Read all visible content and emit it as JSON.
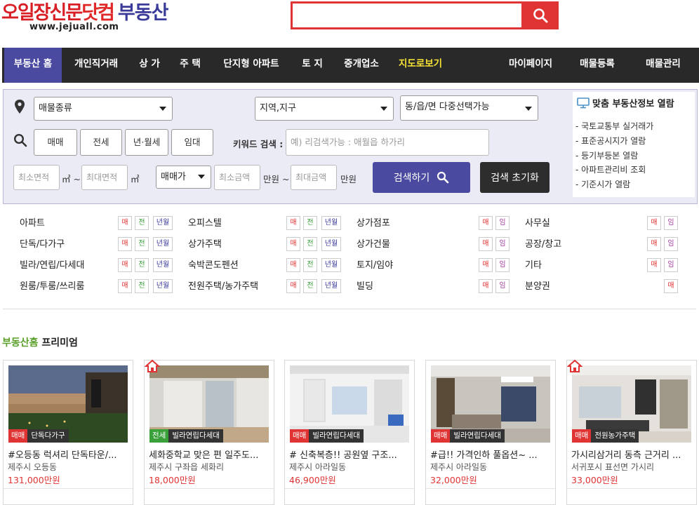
{
  "header": {
    "logo_part1": "오일장신문",
    "logo_part2": "닷컴",
    "logo_part3": "부동산",
    "logo_url": "www.jejuall.com",
    "search_placeholder": ""
  },
  "nav": {
    "items": [
      "부동산 홈",
      "개인직거래",
      "상 가",
      "주 택",
      "단지형 아파트",
      "토 지",
      "중개업소",
      "지도로보기"
    ],
    "right_items": [
      "마이페이지",
      "매물등록",
      "매물관리"
    ]
  },
  "filter": {
    "property_type": "매물종류",
    "region": "지역,지구",
    "dong": "동/읍/면 다중선택가능",
    "trade_buttons": [
      "매매",
      "전세",
      "년·월세",
      "임대"
    ],
    "keyword_label": "키워드 검색 :",
    "keyword_placeholder": "예) 리검색가능 : 애월읍 하가리",
    "min_area": "최소면적",
    "max_area": "최대면적",
    "area_unit": "㎡",
    "tilde": "~",
    "price_type": "매매가",
    "min_price": "최소금액",
    "max_price": "최대금액",
    "price_unit_tilde": "만원 ~",
    "price_unit": "만원",
    "search_button": "검색하기",
    "reset_button": "검색 초기화"
  },
  "side_panel": {
    "title": "맞춤 부동산정보 열람",
    "links": [
      "- 국토교통부 실거래가",
      "- 표준공시지가 열람",
      "- 등기부등본 열람",
      "- 아파트관리비 조회",
      "- 기준시가 열람"
    ]
  },
  "categories": {
    "col1": [
      "아파트",
      "단독/다가구",
      "빌라/연립/다세대",
      "원룸/투룸/쓰리룸"
    ],
    "col2": [
      "오피스텔",
      "상가주택",
      "숙박콘도펜션",
      "전원주택/농가주택"
    ],
    "col3": [
      "상가점포",
      "상가건물",
      "토지/임야",
      "빌딩"
    ],
    "col4": [
      "사무실",
      "공장/창고",
      "기타",
      "분양권"
    ],
    "tag_sale": "매",
    "tag_jeonse": "전",
    "tag_monthly": "년월",
    "tag_rent": "임"
  },
  "premium": {
    "title_green": "부동산홈",
    "title_black": " 프리미엄",
    "cards": [
      {
        "type": "매매",
        "category": "단독다가구",
        "title": "#오등동 럭셔리 단독타운/...",
        "location": "제주시 오등동",
        "price": "131,000만원"
      },
      {
        "type": "전세",
        "category": "빌라연립다세대",
        "title": "세화중학교 맞은 편 일주도...",
        "location": "제주시 구좌읍 세화리",
        "price": "18,000만원"
      },
      {
        "type": "매매",
        "category": "빌라연립다세대",
        "title": "# 신축복층!! 공원옆 구조...",
        "location": "제주시 아라일동",
        "price": "46,900만원"
      },
      {
        "type": "매매",
        "category": "빌라연립다세대",
        "title": "#급!! 가격인하 풀옵션~ ...",
        "location": "제주시 아라일동",
        "price": "32,000만원"
      },
      {
        "type": "매매",
        "category": "전원농가주택",
        "title": "가시리삼거리 동측 근거리 ...",
        "location": "서귀포시 표선면 가시리",
        "price": "33,000만원"
      }
    ]
  },
  "colors": {
    "accent_red": "#e03434",
    "nav_bg": "#292929",
    "nav_active": "#4a4aa0",
    "premium_green": "#5a9f2a"
  }
}
